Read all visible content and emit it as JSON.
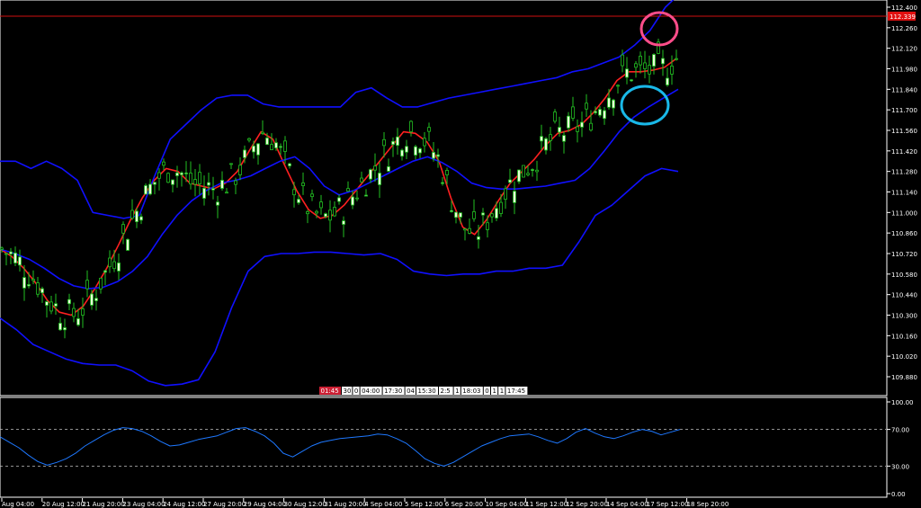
{
  "chart_data": [
    {
      "type": "candlestick",
      "panel": "main",
      "y_ticks": [
        "112.400",
        "112.260",
        "112.120",
        "111.980",
        "111.840",
        "111.700",
        "111.560",
        "111.420",
        "111.280",
        "111.140",
        "111.000",
        "110.860",
        "110.720",
        "110.580",
        "110.440",
        "110.300",
        "110.160",
        "110.020",
        "109.880"
      ],
      "ylim": [
        109.8,
        112.42
      ],
      "current_price_label": "112.339",
      "current_price": 112.339,
      "time_scrollbar_labels": [
        "01:45",
        "30",
        "0",
        "04:00",
        "17:30",
        "04",
        "15:30",
        "2:5",
        "1",
        "18:03",
        "0",
        "1",
        "1",
        "17:45"
      ],
      "x_labels": [
        "Aug 04:00",
        "20 Aug 12:00",
        "21 Aug 20:00",
        "23 Aug 04:00",
        "24 Aug 12:00",
        "27 Aug 20:00",
        "29 Aug 04:00",
        "30 Aug 12:00",
        "31 Aug 20:00",
        "4 Sep 04:00",
        "5 Sep 12:00",
        "6 Sep 20:00",
        "10 Sep 04:00",
        "11 Sep 12:00",
        "12 Sep 20:00",
        "14 Sep 04:00",
        "17 Sep 12:00",
        "18 Sep 20:00"
      ],
      "series": [
        {
          "name": "",
          "kind": "ma",
          "color": "#ff2020",
          "values": [
            110.75,
            110.7,
            110.62,
            110.52,
            110.4,
            110.32,
            110.3,
            110.36,
            110.48,
            110.62,
            110.78,
            110.95,
            111.1,
            111.22,
            111.3,
            111.28,
            111.2,
            111.18,
            111.16,
            111.2,
            111.28,
            111.42,
            111.55,
            111.5,
            111.32,
            111.15,
            111.02,
            110.96,
            110.98,
            111.05,
            111.15,
            111.25,
            111.35,
            111.45,
            111.55,
            111.54,
            111.48,
            111.35,
            111.1,
            110.9,
            110.85,
            110.95,
            111.08,
            111.2,
            111.28,
            111.36,
            111.46,
            111.54,
            111.56,
            111.6,
            111.68,
            111.78,
            111.9,
            111.96,
            111.96,
            111.97,
            111.99,
            112.05
          ]
        },
        {
          "name": "",
          "kind": "bollinger-upper",
          "color": "#1010ff",
          "values": [
            111.35,
            111.35,
            111.3,
            111.35,
            111.3,
            111.22,
            111.0,
            110.98,
            110.96,
            110.98,
            111.25,
            111.5,
            111.6,
            111.7,
            111.78,
            111.8,
            111.8,
            111.74,
            111.72,
            111.72,
            111.72,
            111.72,
            111.72,
            111.82,
            111.85,
            111.78,
            111.72,
            111.72,
            111.75,
            111.78,
            111.8,
            111.82,
            111.84,
            111.86,
            111.88,
            111.9,
            111.92,
            111.96,
            111.98,
            112.02,
            112.06,
            112.14,
            112.24,
            112.4,
            112.5
          ]
        },
        {
          "name": "",
          "kind": "bollinger-middle",
          "color": "#1010ff",
          "values": [
            110.75,
            110.72,
            110.68,
            110.62,
            110.55,
            110.5,
            110.48,
            110.49,
            110.53,
            110.6,
            110.7,
            110.85,
            110.98,
            111.08,
            111.15,
            111.2,
            111.22,
            111.25,
            111.3,
            111.35,
            111.38,
            111.3,
            111.18,
            111.12,
            111.15,
            111.2,
            111.25,
            111.3,
            111.35,
            111.38,
            111.34,
            111.28,
            111.2,
            111.17,
            111.16,
            111.16,
            111.17,
            111.18,
            111.2,
            111.22,
            111.3,
            111.42,
            111.55,
            111.65,
            111.72,
            111.78,
            111.84
          ]
        },
        {
          "name": "",
          "kind": "bollinger-lower",
          "color": "#1010ff",
          "values": [
            110.28,
            110.2,
            110.1,
            110.05,
            110.0,
            109.97,
            109.96,
            109.96,
            109.92,
            109.85,
            109.82,
            109.83,
            109.86,
            110.05,
            110.35,
            110.6,
            110.7,
            110.72,
            110.72,
            110.73,
            110.73,
            110.72,
            110.71,
            110.72,
            110.68,
            110.6,
            110.58,
            110.57,
            110.58,
            110.58,
            110.6,
            110.6,
            110.62,
            110.62,
            110.64,
            110.8,
            110.98,
            111.05,
            111.15,
            111.25,
            111.3,
            111.28
          ]
        }
      ]
    },
    {
      "type": "line",
      "panel": "oscillator",
      "y_ticks": [
        "100.00",
        "70.00",
        "30.00",
        "0.00"
      ],
      "ylim": [
        0,
        100
      ],
      "levels": [
        70,
        30
      ],
      "series": [
        {
          "name": "",
          "color": "#1e78ff",
          "values": [
            62,
            56,
            50,
            42,
            35,
            31,
            34,
            38,
            44,
            52,
            58,
            64,
            69,
            72,
            71,
            68,
            63,
            57,
            52,
            53,
            56,
            59,
            61,
            63,
            67,
            71,
            72,
            68,
            63,
            55,
            44,
            40,
            46,
            52,
            56,
            58,
            60,
            61,
            62,
            63,
            65,
            64,
            60,
            55,
            47,
            38,
            33,
            30,
            34,
            40,
            46,
            52,
            56,
            60,
            63,
            64,
            65,
            62,
            58,
            55,
            60,
            67,
            71,
            66,
            62,
            60,
            63,
            67,
            70,
            68,
            64,
            67,
            70
          ]
        }
      ]
    }
  ]
}
